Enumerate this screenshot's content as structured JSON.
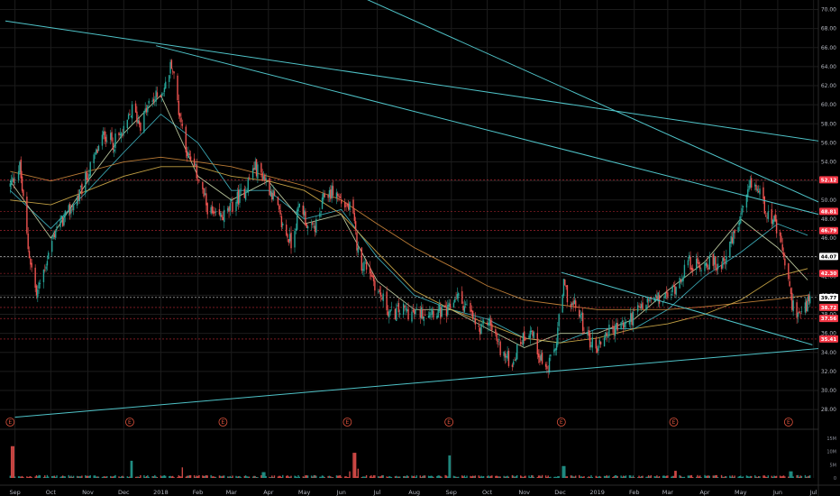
{
  "colors": {
    "background": "#000000",
    "grid": "#1c1c1c",
    "up": "#26a69a",
    "down": "#ef5350",
    "trendline": "#4fc3c8",
    "ma_cyan": "#3fb7c4",
    "ma_white": "#c9d6a8",
    "ma_orange": "#d08a3c",
    "ma_gold": "#d6b04a",
    "red_tag": "#f23645",
    "green_tag": "#22ab5b",
    "white_tag": "#ffffff"
  },
  "chart_data": {
    "type": "candlestick",
    "x_labels": [
      {
        "label": "Sep",
        "date": "2017-09-01"
      },
      {
        "label": "Oct",
        "date": "2017-10-01"
      },
      {
        "label": "Nov",
        "date": "2017-11-01"
      },
      {
        "label": "Dec",
        "date": "2017-12-01"
      },
      {
        "label": "2018",
        "date": "2018-01-01"
      },
      {
        "label": "Feb",
        "date": "2018-02-01"
      },
      {
        "label": "Mar",
        "date": "2018-03-01"
      },
      {
        "label": "Apr",
        "date": "2018-04-01"
      },
      {
        "label": "May",
        "date": "2018-05-01"
      },
      {
        "label": "Jun",
        "date": "2018-06-01"
      },
      {
        "label": "Jul",
        "date": "2018-07-01"
      },
      {
        "label": "Aug",
        "date": "2018-08-01"
      },
      {
        "label": "Sep",
        "date": "2018-09-01"
      },
      {
        "label": "Oct",
        "date": "2018-10-01"
      },
      {
        "label": "Nov",
        "date": "2018-11-01"
      },
      {
        "label": "Dec",
        "date": "2018-12-01"
      },
      {
        "label": "2019",
        "date": "2019-01-01"
      },
      {
        "label": "Feb",
        "date": "2019-02-01"
      },
      {
        "label": "Mar",
        "date": "2019-03-01"
      },
      {
        "label": "Apr",
        "date": "2019-04-01"
      },
      {
        "label": "May",
        "date": "2019-05-01"
      },
      {
        "label": "Jun",
        "date": "2019-06-01"
      },
      {
        "label": "Jul",
        "date": "2019-07-01"
      }
    ],
    "x_range": [
      "2017-08-24",
      "2019-07-05"
    ],
    "price_axis": {
      "ylim": [
        26.5,
        71.0
      ],
      "ticks": [
        "28.00",
        "30.00",
        "32.00",
        "34.00",
        "36.00",
        "38.00",
        "40.00",
        "42.00",
        "44.00",
        "46.00",
        "48.00",
        "50.00",
        "52.00",
        "54.00",
        "56.00",
        "58.00",
        "60.00",
        "62.00",
        "64.00",
        "66.00",
        "68.00",
        "70.00"
      ]
    },
    "volume_axis": {
      "ylim": [
        0,
        16
      ],
      "ticks": [
        {
          "label": "15M",
          "value": 15
        },
        {
          "label": "10M",
          "value": 10
        },
        {
          "label": "5M",
          "value": 5
        },
        {
          "label": "0",
          "value": 0
        }
      ]
    },
    "price_path": [
      {
        "date": "2017-08-28",
        "close": 51.5
      },
      {
        "date": "2017-09-05",
        "close": 53.5
      },
      {
        "date": "2017-09-12",
        "close": 45.0
      },
      {
        "date": "2017-09-19",
        "close": 40.0
      },
      {
        "date": "2017-09-26",
        "close": 43.0
      },
      {
        "date": "2017-10-05",
        "close": 47.0
      },
      {
        "date": "2017-10-15",
        "close": 48.5
      },
      {
        "date": "2017-10-25",
        "close": 50.5
      },
      {
        "date": "2017-11-05",
        "close": 54.0
      },
      {
        "date": "2017-11-15",
        "close": 57.0
      },
      {
        "date": "2017-11-22",
        "close": 56.0
      },
      {
        "date": "2017-12-01",
        "close": 57.0
      },
      {
        "date": "2017-12-08",
        "close": 59.5
      },
      {
        "date": "2017-12-15",
        "close": 58.0
      },
      {
        "date": "2017-12-22",
        "close": 60.0
      },
      {
        "date": "2017-12-30",
        "close": 61.0
      },
      {
        "date": "2018-01-05",
        "close": 62.0
      },
      {
        "date": "2018-01-10",
        "close": 64.5
      },
      {
        "date": "2018-01-16",
        "close": 59.5
      },
      {
        "date": "2018-01-24",
        "close": 54.5
      },
      {
        "date": "2018-02-01",
        "close": 52.5
      },
      {
        "date": "2018-02-08",
        "close": 49.5
      },
      {
        "date": "2018-02-15",
        "close": 48.0
      },
      {
        "date": "2018-02-25",
        "close": 48.5
      },
      {
        "date": "2018-03-05",
        "close": 50.0
      },
      {
        "date": "2018-03-12",
        "close": 51.0
      },
      {
        "date": "2018-03-20",
        "close": 53.5
      },
      {
        "date": "2018-03-28",
        "close": 52.5
      },
      {
        "date": "2018-04-05",
        "close": 50.5
      },
      {
        "date": "2018-04-12",
        "close": 47.5
      },
      {
        "date": "2018-04-20",
        "close": 45.5
      },
      {
        "date": "2018-04-28",
        "close": 50.0
      },
      {
        "date": "2018-05-05",
        "close": 46.5
      },
      {
        "date": "2018-05-12",
        "close": 47.5
      },
      {
        "date": "2018-05-18",
        "close": 50.5
      },
      {
        "date": "2018-05-26",
        "close": 51.0
      },
      {
        "date": "2018-06-03",
        "close": 49.5
      },
      {
        "date": "2018-06-10",
        "close": 49.0
      },
      {
        "date": "2018-06-16",
        "close": 43.5
      },
      {
        "date": "2018-06-24",
        "close": 43.0
      },
      {
        "date": "2018-07-01",
        "close": 40.5
      },
      {
        "date": "2018-07-06",
        "close": 39.5
      },
      {
        "date": "2018-07-12",
        "close": 38.0
      },
      {
        "date": "2018-07-22",
        "close": 38.5
      },
      {
        "date": "2018-08-01",
        "close": 38.0
      },
      {
        "date": "2018-08-15",
        "close": 38.5
      },
      {
        "date": "2018-08-28",
        "close": 38.0
      },
      {
        "date": "2018-09-05",
        "close": 40.0
      },
      {
        "date": "2018-09-15",
        "close": 38.5
      },
      {
        "date": "2018-09-25",
        "close": 36.0
      },
      {
        "date": "2018-10-02",
        "close": 37.5
      },
      {
        "date": "2018-10-10",
        "close": 35.0
      },
      {
        "date": "2018-10-16",
        "close": 33.5
      },
      {
        "date": "2018-10-22",
        "close": 33.0
      },
      {
        "date": "2018-10-30",
        "close": 35.5
      },
      {
        "date": "2018-11-06",
        "close": 36.5
      },
      {
        "date": "2018-11-13",
        "close": 34.0
      },
      {
        "date": "2018-11-20",
        "close": 32.0
      },
      {
        "date": "2018-11-27",
        "close": 34.5
      },
      {
        "date": "2018-12-04",
        "close": 41.0
      },
      {
        "date": "2018-12-10",
        "close": 39.0
      },
      {
        "date": "2018-12-16",
        "close": 38.5
      },
      {
        "date": "2018-12-24",
        "close": 35.5
      },
      {
        "date": "2019-01-01",
        "close": 34.5
      },
      {
        "date": "2019-01-08",
        "close": 36.0
      },
      {
        "date": "2019-01-15",
        "close": 36.5
      },
      {
        "date": "2019-01-25",
        "close": 37.0
      },
      {
        "date": "2019-02-05",
        "close": 38.5
      },
      {
        "date": "2019-02-15",
        "close": 39.5
      },
      {
        "date": "2019-02-25",
        "close": 39.5
      },
      {
        "date": "2019-03-05",
        "close": 40.5
      },
      {
        "date": "2019-03-12",
        "close": 42.0
      },
      {
        "date": "2019-03-18",
        "close": 43.5
      },
      {
        "date": "2019-03-26",
        "close": 43.0
      },
      {
        "date": "2019-04-04",
        "close": 43.5
      },
      {
        "date": "2019-04-12",
        "close": 43.0
      },
      {
        "date": "2019-04-20",
        "close": 44.5
      },
      {
        "date": "2019-04-28",
        "close": 47.0
      },
      {
        "date": "2019-05-05",
        "close": 49.5
      },
      {
        "date": "2019-05-10",
        "close": 51.8
      },
      {
        "date": "2019-05-16",
        "close": 51.0
      },
      {
        "date": "2019-05-22",
        "close": 49.0
      },
      {
        "date": "2019-05-28",
        "close": 48.0
      },
      {
        "date": "2019-06-03",
        "close": 45.5
      },
      {
        "date": "2019-06-08",
        "close": 43.0
      },
      {
        "date": "2019-06-12",
        "close": 39.5
      },
      {
        "date": "2019-06-17",
        "close": 38.2
      },
      {
        "date": "2019-06-21",
        "close": 38.0
      },
      {
        "date": "2019-06-25",
        "close": 38.8
      },
      {
        "date": "2019-06-28",
        "close": 39.6
      }
    ],
    "trendlines": [
      {
        "p1": {
          "date": "2017-08-24",
          "price": 68.8
        },
        "p2": {
          "date": "2019-07-05",
          "price": 56.2
        }
      },
      {
        "p1": {
          "date": "2017-12-28",
          "price": 66.2
        },
        "p2": {
          "date": "2019-07-05",
          "price": 48.5
        }
      },
      {
        "p1": {
          "date": "2018-05-10",
          "price": 73.5
        },
        "p2": {
          "date": "2019-07-05",
          "price": 49.8
        }
      },
      {
        "p1": {
          "date": "2018-12-02",
          "price": 42.4
        },
        "p2": {
          "date": "2019-06-30",
          "price": 34.8
        }
      },
      {
        "p1": {
          "date": "2017-09-01",
          "price": 27.2
        },
        "p2": {
          "date": "2019-07-05",
          "price": 34.4
        }
      }
    ],
    "moving_averages": [
      {
        "color": "ma_cyan",
        "points": [
          [
            "2017-08-28",
            51.0
          ],
          [
            "2017-10-01",
            47.0
          ],
          [
            "2017-11-01",
            51.0
          ],
          [
            "2017-12-01",
            55.0
          ],
          [
            "2018-01-01",
            59.0
          ],
          [
            "2018-02-01",
            56.0
          ],
          [
            "2018-03-01",
            51.0
          ],
          [
            "2018-04-01",
            51.0
          ],
          [
            "2018-05-01",
            48.0
          ],
          [
            "2018-06-01",
            49.0
          ],
          [
            "2018-07-01",
            44.0
          ],
          [
            "2018-08-01",
            40.0
          ],
          [
            "2018-09-01",
            38.5
          ],
          [
            "2018-10-01",
            37.5
          ],
          [
            "2018-11-01",
            35.5
          ],
          [
            "2018-12-01",
            35.0
          ],
          [
            "2019-01-01",
            36.5
          ],
          [
            "2019-02-01",
            36.5
          ],
          [
            "2019-03-01",
            38.5
          ],
          [
            "2019-04-01",
            42.0
          ],
          [
            "2019-05-01",
            44.5
          ],
          [
            "2019-06-01",
            47.5
          ],
          [
            "2019-06-26",
            46.3
          ]
        ]
      },
      {
        "color": "ma_white",
        "points": [
          [
            "2017-08-28",
            52.0
          ],
          [
            "2017-10-01",
            46.0
          ],
          [
            "2017-11-01",
            52.0
          ],
          [
            "2017-12-01",
            57.0
          ],
          [
            "2018-01-01",
            61.0
          ],
          [
            "2018-02-01",
            52.5
          ],
          [
            "2018-03-01",
            50.0
          ],
          [
            "2018-04-01",
            52.0
          ],
          [
            "2018-05-01",
            47.5
          ],
          [
            "2018-06-01",
            48.5
          ],
          [
            "2018-07-01",
            41.5
          ],
          [
            "2018-08-01",
            38.5
          ],
          [
            "2018-09-01",
            38.5
          ],
          [
            "2018-10-01",
            36.5
          ],
          [
            "2018-11-01",
            34.5
          ],
          [
            "2018-12-01",
            36.0
          ],
          [
            "2019-01-01",
            36.0
          ],
          [
            "2019-02-01",
            37.5
          ],
          [
            "2019-03-01",
            40.5
          ],
          [
            "2019-04-01",
            43.5
          ],
          [
            "2019-05-01",
            48.0
          ],
          [
            "2019-06-01",
            45.0
          ],
          [
            "2019-06-26",
            41.6
          ]
        ]
      },
      {
        "color": "ma_orange",
        "points": [
          [
            "2017-08-28",
            53.0
          ],
          [
            "2017-10-01",
            52.0
          ],
          [
            "2017-11-01",
            53.0
          ],
          [
            "2017-12-01",
            54.0
          ],
          [
            "2018-01-01",
            54.5
          ],
          [
            "2018-02-01",
            54.0
          ],
          [
            "2018-03-01",
            53.5
          ],
          [
            "2018-04-01",
            52.5
          ],
          [
            "2018-05-01",
            51.5
          ],
          [
            "2018-06-01",
            50.0
          ],
          [
            "2018-07-01",
            47.5
          ],
          [
            "2018-08-01",
            45.0
          ],
          [
            "2018-09-01",
            43.0
          ],
          [
            "2018-10-01",
            41.0
          ],
          [
            "2018-11-01",
            39.5
          ],
          [
            "2018-12-01",
            39.0
          ],
          [
            "2019-01-01",
            38.5
          ],
          [
            "2019-02-01",
            38.5
          ],
          [
            "2019-03-01",
            38.5
          ],
          [
            "2019-04-01",
            38.8
          ],
          [
            "2019-05-01",
            39.2
          ],
          [
            "2019-06-01",
            39.6
          ],
          [
            "2019-06-26",
            40.0
          ]
        ]
      },
      {
        "color": "ma_gold",
        "points": [
          [
            "2017-08-28",
            50.0
          ],
          [
            "2017-10-01",
            49.5
          ],
          [
            "2017-11-01",
            51.0
          ],
          [
            "2017-12-01",
            52.5
          ],
          [
            "2018-01-01",
            53.5
          ],
          [
            "2018-02-01",
            53.5
          ],
          [
            "2018-03-01",
            52.5
          ],
          [
            "2018-04-01",
            52.0
          ],
          [
            "2018-05-01",
            51.0
          ],
          [
            "2018-06-01",
            48.5
          ],
          [
            "2018-07-01",
            44.5
          ],
          [
            "2018-08-01",
            40.5
          ],
          [
            "2018-09-01",
            38.5
          ],
          [
            "2018-10-01",
            37.0
          ],
          [
            "2018-11-01",
            35.5
          ],
          [
            "2018-12-01",
            35.0
          ],
          [
            "2019-01-01",
            35.5
          ],
          [
            "2019-02-01",
            36.5
          ],
          [
            "2019-03-01",
            37.0
          ],
          [
            "2019-04-01",
            38.0
          ],
          [
            "2019-05-01",
            39.5
          ],
          [
            "2019-06-01",
            42.0
          ],
          [
            "2019-06-26",
            42.8
          ]
        ]
      }
    ],
    "dotted_horizontal_levels": [
      {
        "price": 52.12,
        "color": "red_tag"
      },
      {
        "price": 48.81,
        "color": "red_tag"
      },
      {
        "price": 46.79,
        "color": "red_tag"
      },
      {
        "price": 44.07,
        "color": "white_tag"
      },
      {
        "price": 42.3,
        "color": "red_tag"
      },
      {
        "price": 39.77,
        "color": "white_tag"
      },
      {
        "price": 38.72,
        "color": "red_tag"
      },
      {
        "price": 37.56,
        "color": "red_tag"
      },
      {
        "price": 35.41,
        "color": "red_tag"
      }
    ],
    "price_tags": [
      {
        "label": "52.12",
        "price": 52.12,
        "color": "red_tag"
      },
      {
        "label": "48.81",
        "price": 48.81,
        "color": "red_tag"
      },
      {
        "label": "46.79",
        "price": 46.79,
        "color": "red_tag"
      },
      {
        "label": "44.07",
        "price": 44.07,
        "color": "white_tag"
      },
      {
        "label": "42.30",
        "price": 42.3,
        "color": "red_tag"
      },
      {
        "label": "39.77",
        "price": 39.77,
        "color": "white_tag"
      },
      {
        "label": "38.73",
        "price": 38.73,
        "color": "green_tag"
      },
      {
        "label": "38.72",
        "price": 38.72,
        "color": "red_tag"
      },
      {
        "label": "37.56",
        "price": 37.56,
        "color": "red_tag"
      },
      {
        "label": "35.41",
        "price": 35.41,
        "color": "red_tag"
      }
    ],
    "earnings_markers": {
      "label": "E",
      "dates": [
        "2017-08-28",
        "2017-12-06",
        "2018-02-22",
        "2018-06-06",
        "2018-08-30",
        "2018-12-02",
        "2019-03-06",
        "2019-06-10"
      ]
    },
    "volume_spikes": [
      {
        "date": "2017-08-30",
        "value": 12.0,
        "dir": "down"
      },
      {
        "date": "2017-12-08",
        "value": 6.5,
        "dir": "up"
      },
      {
        "date": "2018-01-20",
        "value": 4.0,
        "dir": "down"
      },
      {
        "date": "2018-03-28",
        "value": 2.2,
        "dir": "up"
      },
      {
        "date": "2018-06-09",
        "value": 2.5,
        "dir": "down"
      },
      {
        "date": "2018-06-12",
        "value": 9.5,
        "dir": "down"
      },
      {
        "date": "2018-06-16",
        "value": 3.5,
        "dir": "down"
      },
      {
        "date": "2018-08-31",
        "value": 8.5,
        "dir": "up"
      },
      {
        "date": "2018-12-04",
        "value": 4.5,
        "dir": "up"
      },
      {
        "date": "2019-03-08",
        "value": 2.7,
        "dir": "down"
      },
      {
        "date": "2019-06-12",
        "value": 2.5,
        "dir": "up"
      }
    ]
  }
}
